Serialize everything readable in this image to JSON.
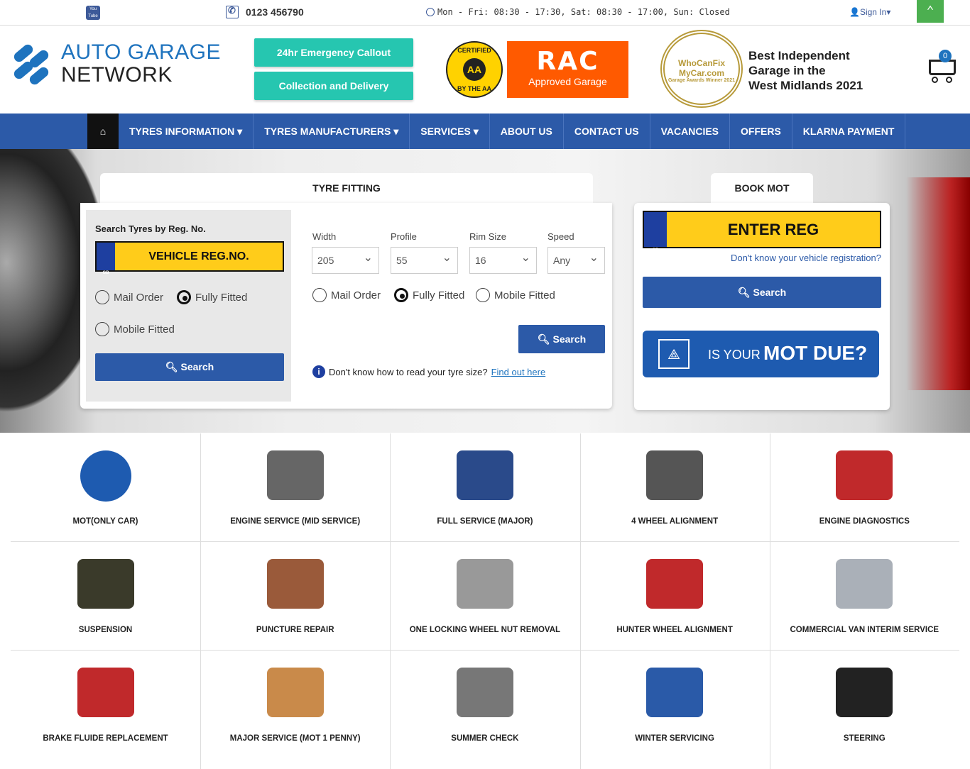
{
  "topbar": {
    "youtube_label": "You Tube",
    "phone": "0123 456790",
    "hours": "Mon - Fri: 08:30 - 17:30, Sat: 08:30 - 17:00, Sun: Closed",
    "signin": "Sign In▾"
  },
  "header": {
    "logo_line1": "AUTO GARAGE",
    "logo_line2": "NETWORK",
    "btn_emergency": "24hr Emergency Callout",
    "btn_collection": "Collection and Delivery",
    "aa_top": "CERTIFIED",
    "aa_bottom": "BY THE AA",
    "aa_mark": "AA",
    "rac_logo": "RAC",
    "rac_sub": "Approved Garage",
    "award_line1": "WhoCanFix",
    "award_line2": "MyCar.com",
    "award_line3": "Garage Awards Winner 2021",
    "award_text1": "Best Independent",
    "award_text2": "Garage in the",
    "award_text3": "West Midlands 2021",
    "cart_count": "0"
  },
  "nav": {
    "items": [
      "TYRES INFORMATION ▾",
      "TYRES MANUFACTURERS ▾",
      "SERVICES ▾",
      "ABOUT US",
      "CONTACT US",
      "VACANCIES",
      "OFFERS",
      "KLARNA PAYMENT"
    ]
  },
  "tyre": {
    "tab": "TYRE FITTING",
    "reg_title": "Search Tyres by Reg. No.",
    "reg_placeholder": "VEHICLE REG.NO.",
    "gb": "GB",
    "opt_mail": "Mail Order",
    "opt_fully": "Fully Fitted",
    "opt_mobile": "Mobile Fitted",
    "search": "Search",
    "width_label": "Width",
    "profile_label": "Profile",
    "rim_label": "Rim Size",
    "speed_label": "Speed",
    "width_value": "205",
    "profile_value": "55",
    "rim_value": "16",
    "speed_value": "Any",
    "help_text": "Don't know how to read your tyre size?",
    "help_link": "Find out here"
  },
  "mot": {
    "tab": "BOOK MOT",
    "reg": "ENTER REG",
    "gb": "GB",
    "dont_know": "Don't know your vehicle registration?",
    "search": "Search",
    "banner_small": "IS YOUR",
    "banner_big": "MOT DUE?"
  },
  "services": [
    {
      "name": "MOT(ONLY CAR)",
      "color": "#1e5bb0"
    },
    {
      "name": "ENGINE SERVICE (MID SERVICE)",
      "color": "#666666"
    },
    {
      "name": "FULL SERVICE (MAJOR)",
      "color": "#2a4a8a"
    },
    {
      "name": "4 WHEEL ALIGNMENT",
      "color": "#555555"
    },
    {
      "name": "ENGINE DIAGNOSTICS",
      "color": "#c0292b"
    },
    {
      "name": "SUSPENSION",
      "color": "#3a3a2a"
    },
    {
      "name": "PUNCTURE REPAIR",
      "color": "#9a5a3a"
    },
    {
      "name": "ONE LOCKING WHEEL NUT REMOVAL",
      "color": "#999999"
    },
    {
      "name": "HUNTER WHEEL ALIGNMENT",
      "color": "#c0292b"
    },
    {
      "name": "COMMERCIAL VAN INTERIM SERVICE",
      "color": "#aab0b8"
    },
    {
      "name": "BRAKE FLUIDE REPLACEMENT",
      "color": "#c0292b"
    },
    {
      "name": "MAJOR SERVICE (MOT 1 PENNY)",
      "color": "#c98a4a"
    },
    {
      "name": "SUMMER CHECK",
      "color": "#777777"
    },
    {
      "name": "WINTER SERVICING",
      "color": "#2a5aa8"
    },
    {
      "name": "STEERING",
      "color": "#222222"
    }
  ]
}
